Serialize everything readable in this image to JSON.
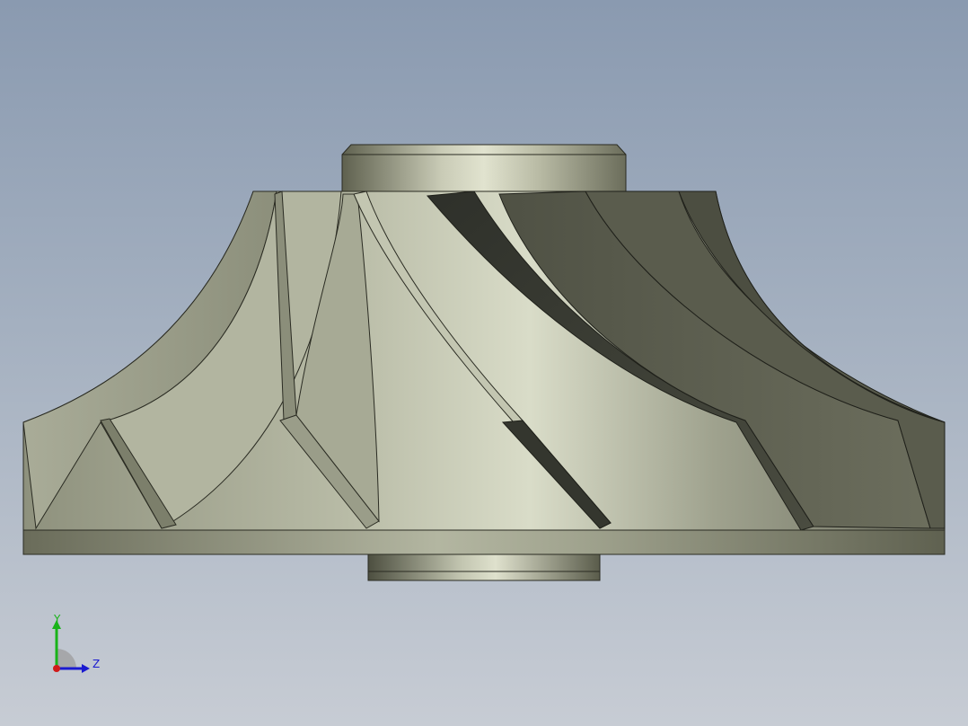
{
  "viewport": {
    "background_top": "#8a9ab0",
    "background_bottom": "#c7ccd4"
  },
  "model": {
    "part": "impeller-icon",
    "color": "#9fa290",
    "blade_color_dark": "#3b3d33",
    "blade_color_light": "#a9ac98"
  },
  "triad": {
    "y_label": "Y",
    "z_label": "Z",
    "y_color": "#19b319",
    "z_color": "#1a1ad0",
    "x_color": "#d01a1a"
  }
}
